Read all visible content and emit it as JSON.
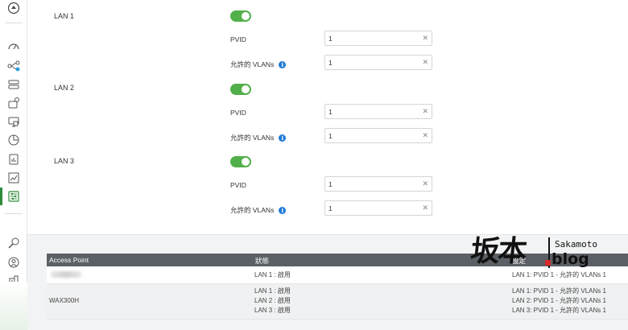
{
  "lans": [
    {
      "label": "LAN 1",
      "pvid_label": "PVID",
      "pvid_value": "1",
      "vlans_label": "允許的 VLANs",
      "vlans_value": "1"
    },
    {
      "label": "LAN 2",
      "pvid_label": "PVID",
      "pvid_value": "1",
      "vlans_label": "允許的 VLANs",
      "vlans_value": "1"
    },
    {
      "label": "LAN 3",
      "pvid_label": "PVID",
      "pvid_value": "1",
      "vlans_label": "允許的 VLANs",
      "vlans_value": "1"
    }
  ],
  "table": {
    "headers": [
      "Access Point",
      "狀態",
      "設定"
    ],
    "rows": [
      {
        "name": "",
        "status": [
          "LAN 1 : 啟用"
        ],
        "config": [
          "LAN 1: PVID 1 - 允許的 VLANs 1"
        ]
      },
      {
        "name": "WAX300H",
        "status": [
          "LAN 1 : 啟用",
          "LAN 2 : 啟用",
          "LAN 3 : 啟用"
        ],
        "config": [
          "LAN 1: PVID 1 - 允許的 VLANs 1",
          "LAN 2: PVID 1 - 允許的 VLANs 1",
          "LAN 3: PVID 1 - 允許的 VLANs 1"
        ]
      }
    ]
  },
  "watermark": {
    "kanji": "坂本",
    "latin": "Sakamoto",
    "blog": "blog"
  },
  "colors": {
    "accent_green": "#52b04a",
    "info_blue": "#1f7ad6",
    "table_header": "#5b6066"
  },
  "icons": {
    "sidebar": [
      "logo-icon",
      "dashboard-icon",
      "topology-icon",
      "devices-icon",
      "ap-icon",
      "monitor-icon",
      "pie-chart-icon",
      "report-icon",
      "trend-icon",
      "settings-icon",
      "diagnose-icon",
      "support-icon",
      "building-icon"
    ]
  }
}
